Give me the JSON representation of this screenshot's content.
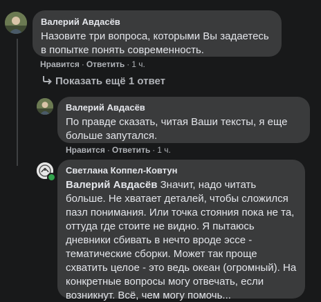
{
  "comment1": {
    "author": "Валерий Авдасёв",
    "text": "Назовите три вопроса, которыми Вы задаетесь в попытке понять современность.",
    "like": "Нравится",
    "reply": "Ответить",
    "time": "1 ч."
  },
  "more_replies": {
    "label": "Показать ещё 1 ответ",
    "icon": "reply-arrow-icon"
  },
  "reply1": {
    "author": "Валерий Авдасёв",
    "text": "По правде сказать, читая Ваши тексты, я еще больше запутался.",
    "like": "Нравится",
    "reply": "Ответить",
    "time": "1 ч."
  },
  "reply2": {
    "author": "Светлана Коппел-Ковтун",
    "mention": "Валерий Авдасёв",
    "text": "Значит, надо читать больше. Не хватает деталей, чтобы сложился пазл понимания. Или точка стояния пока не та, оттуда где стоите не видно. Я пытаюсь дневники сбивать в нечто вроде эссе - тематические сборки. Может так проще схватить целое - это ведь океан (огромный). На конкретные вопросы могу отвечать, если возникнут. Всё, чем могу помочь..."
  },
  "colors": {
    "background": "#18191a",
    "bubble": "#3a3b3c",
    "text": "#e4e6eb",
    "secondary": "#b0b3b8",
    "online": "#31a24c"
  }
}
